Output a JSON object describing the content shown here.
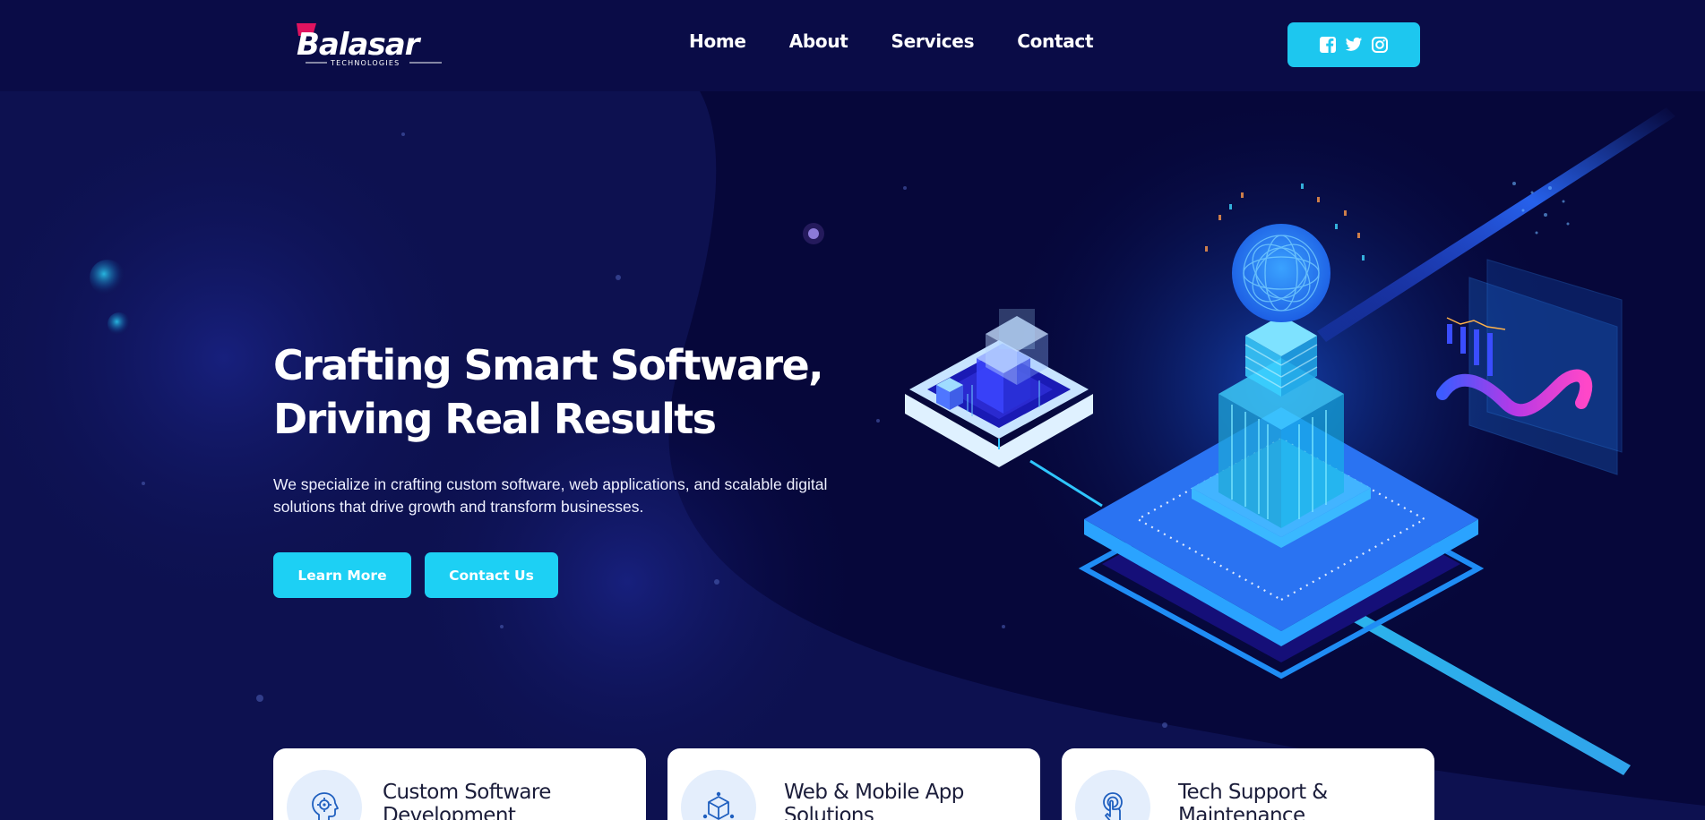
{
  "brand": {
    "name": "Balasar",
    "tagline": "TECHNOLOGIES"
  },
  "nav": {
    "items": [
      {
        "label": "Home"
      },
      {
        "label": "About"
      },
      {
        "label": "Services"
      },
      {
        "label": "Contact"
      }
    ]
  },
  "social": {
    "icons": [
      "facebook-square-icon",
      "twitter-icon",
      "instagram-icon"
    ]
  },
  "hero": {
    "title_line1": "Crafting Smart Software,",
    "title_line2": "Driving Real Results",
    "description": "We specialize in crafting custom software, web applications, and scalable digital solutions that drive growth and transform businesses.",
    "learn_more_label": "Learn More",
    "contact_label": "Contact Us"
  },
  "services": {
    "cards": [
      {
        "title": "Custom Software Development",
        "icon": "ai-gear-head-icon"
      },
      {
        "title": "Web & Mobile App Solutions",
        "icon": "cube-network-icon"
      },
      {
        "title": "Tech Support & Maintenance",
        "icon": "touch-support-icon"
      }
    ]
  },
  "colors": {
    "background": "#0c0f4a",
    "navbar": "#0a0c47",
    "accent": "#1dd0f4",
    "brand_pink": "#e0135f",
    "card": "#ffffff",
    "card_icon_bg": "#e4eefc"
  }
}
